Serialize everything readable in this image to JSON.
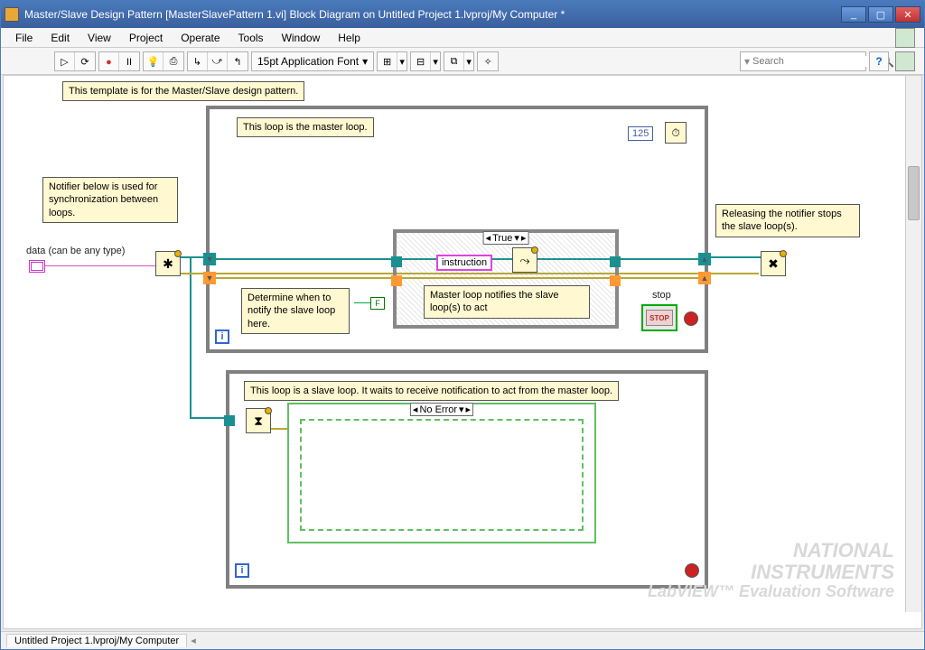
{
  "titlebar": {
    "title": "Master/Slave Design Pattern [MasterSlavePattern 1.vi] Block Diagram on Untitled Project 1.lvproj/My Computer *"
  },
  "menu": {
    "file": "File",
    "edit": "Edit",
    "view": "View",
    "project": "Project",
    "operate": "Operate",
    "tools": "Tools",
    "window": "Window",
    "help": "Help"
  },
  "toolbar": {
    "run": "▷",
    "run_cont": "⟳",
    "abort": "●",
    "pause": "II",
    "highlight": "💡",
    "retain": "⎙",
    "step_into": "↳",
    "step_over": "⤻",
    "step_out": "↰",
    "font_label": "15pt Application Font",
    "align": "⊞",
    "distribute": "⊟",
    "reorder": "⧉",
    "cleanup": "✧",
    "search_placeholder": "Search",
    "help": "?"
  },
  "diagram": {
    "top_comment": "This template is for the Master/Slave design pattern.",
    "master_comment": "This loop is the master loop.",
    "notifier_comment": "Notifier below is used for synchronization between loops.",
    "data_label": "data (can be any type)",
    "determine_comment": "Determine when to notify the slave loop here.",
    "instruction_label": "instruction",
    "notify_comment": "Master loop notifies the slave loop(s) to act",
    "release_comment": "Releasing the notifier stops the slave loop(s).",
    "stop_label": "stop",
    "stop_btn": "STOP",
    "slave_comment": "This loop is a slave loop. It waits to receive notification to act from the master loop.",
    "true_case": "True",
    "noerror_case": "No Error",
    "metronome_val": "125",
    "false_const": "F",
    "iter": "i"
  },
  "statusbar": {
    "path": "Untitled Project 1.lvproj/My Computer"
  },
  "watermark": {
    "line1": "NATIONAL",
    "line2": "INSTRUMENTS",
    "line3": "LabVIEW™ Evaluation Software"
  }
}
